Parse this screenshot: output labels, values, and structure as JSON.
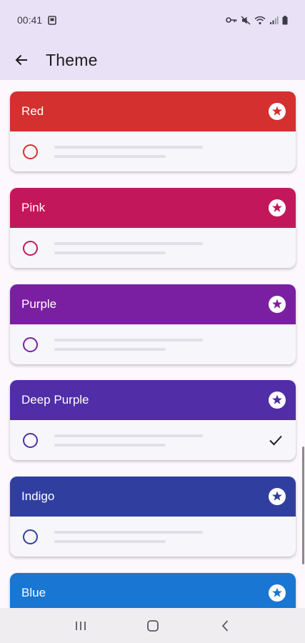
{
  "status_bar": {
    "time": "00:41"
  },
  "app_bar": {
    "title": "Theme",
    "back_icon": "arrow-back-icon"
  },
  "themes": [
    {
      "name": "Red",
      "color": "#d3302f",
      "accent": "#d3302f",
      "selected": false
    },
    {
      "name": "Pink",
      "color": "#c2185b",
      "accent": "#c2185b",
      "selected": false
    },
    {
      "name": "Purple",
      "color": "#7b1fa2",
      "accent": "#7b1fa2",
      "selected": false
    },
    {
      "name": "Deep Purple",
      "color": "#512da8",
      "accent": "#512da8",
      "selected": true
    },
    {
      "name": "Indigo",
      "color": "#303f9f",
      "accent": "#303f9f",
      "selected": false
    },
    {
      "name": "Blue",
      "color": "#1976d2",
      "accent": "#1976d2",
      "selected": false
    }
  ],
  "nav": {
    "recents_icon": "recents-icon",
    "home_icon": "home-icon",
    "back_icon": "back-icon"
  }
}
